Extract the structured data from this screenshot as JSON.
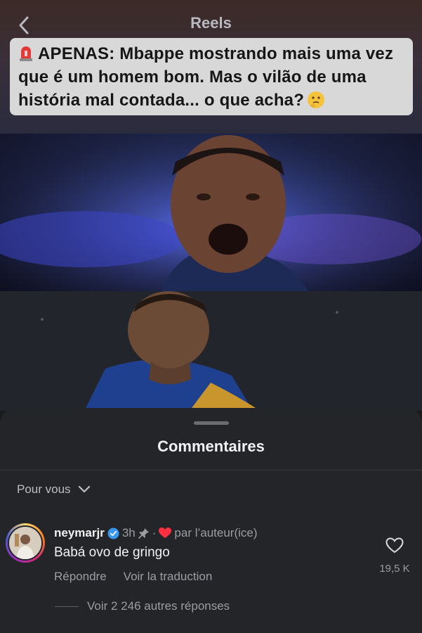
{
  "header": {
    "title": "Reels",
    "back_icon": "chevron-left-icon"
  },
  "caption": {
    "text": "APENAS: Mbappe mostrando mais uma vez que é um homem bom. Mas o vilão de uma história mal contada... o que acha?",
    "leading_emoji": "siren-icon",
    "trailing_emoji": "thinking-face-icon"
  },
  "comments_sheet": {
    "title": "Commentaires",
    "filter_label": "Pour vous",
    "comment": {
      "username": "neymarjr",
      "time": "3h",
      "author_liked_label": "par l’auteur(ice)",
      "separator": "·",
      "text": "Babá ovo de gringo",
      "reply_label": "Répondre",
      "translate_label": "Voir la traduction",
      "like_count": "19,5 K",
      "view_replies_label": "Voir 2 246 autres réponses"
    }
  },
  "colors": {
    "sheet_bg": "#242529",
    "verified_blue": "#3897f0",
    "heart_red": "#ff3040"
  }
}
